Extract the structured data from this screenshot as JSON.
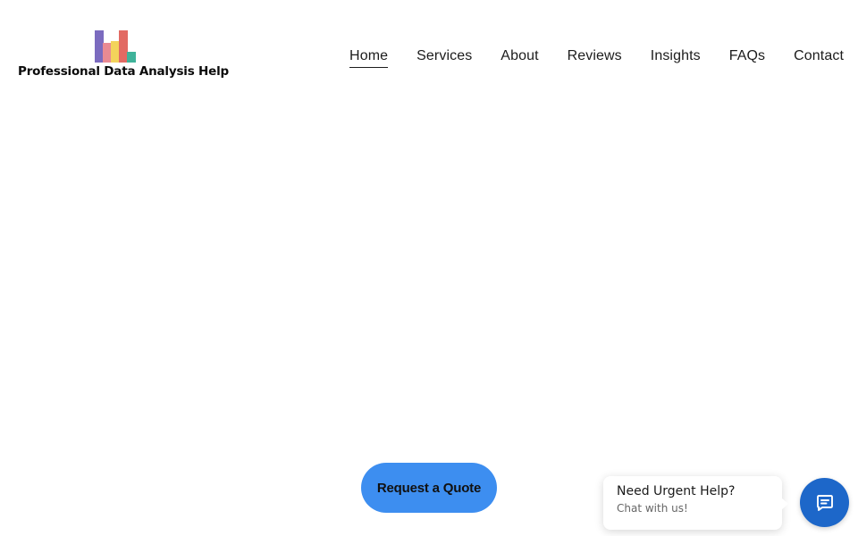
{
  "brand": {
    "name": "Professional Data Analysis Help",
    "logo_colors": [
      "#7b6bbf",
      "#e98a93",
      "#f3d35b",
      "#e26a63",
      "#3fb39a"
    ]
  },
  "nav": {
    "items": [
      {
        "label": "Home",
        "active": true
      },
      {
        "label": "Services",
        "active": false
      },
      {
        "label": "About",
        "active": false
      },
      {
        "label": "Reviews",
        "active": false
      },
      {
        "label": "Insights",
        "active": false
      },
      {
        "label": "FAQs",
        "active": false
      },
      {
        "label": "Contact",
        "active": false
      }
    ]
  },
  "cta": {
    "label": "Request a Quote",
    "color": "#3d8ef0"
  },
  "chat": {
    "title": "Need Urgent Help?",
    "subtitle": "Chat with us!",
    "icon": "chat-icon",
    "color": "#1d67c9"
  }
}
